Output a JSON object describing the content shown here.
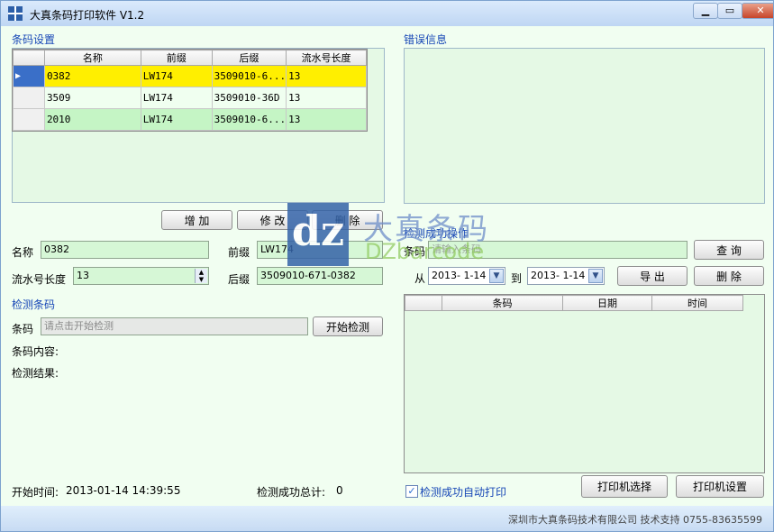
{
  "window": {
    "title": "大真条码打印软件 V1.2",
    "controls": {
      "minimize": "▁",
      "maximize": "▭",
      "close": "✕"
    }
  },
  "barcode_settings": {
    "section_title": "条码设置",
    "columns": [
      "名称",
      "前缀",
      "后缀",
      "流水号长度"
    ],
    "rows": [
      {
        "name": "0382",
        "prefix": "LW174",
        "suffix": "3509010-6...",
        "length": "13"
      },
      {
        "name": "3509",
        "prefix": "LW174",
        "suffix": "3509010-36D",
        "length": "13"
      },
      {
        "name": "2010",
        "prefix": "LW174",
        "suffix": "3509010-6...",
        "length": "13"
      }
    ],
    "add_label": "增 加",
    "edit_label": "修 改",
    "delete_label": "删 除"
  },
  "form": {
    "name_label": "名称",
    "name_value": "0382",
    "prefix_label": "前缀",
    "prefix_value": "LW174",
    "length_label": "流水号长度",
    "length_value": "13",
    "suffix_label": "后缀",
    "suffix_value": "3509010-671-0382"
  },
  "error_info": {
    "section_title": "错误信息"
  },
  "detect": {
    "section_title": "检测条码",
    "barcode_label": "条码",
    "barcode_placeholder": "请点击开始检测",
    "start_label": "开始检测",
    "content_label": "条码内容:",
    "result_label": "检测结果:"
  },
  "success_ops": {
    "section_title": "检测成功操作",
    "barcode_label": "条码",
    "barcode_placeholder": "请输入条码",
    "query_label": "查 询",
    "from_label": "从",
    "from_date": "2013- 1-14",
    "to_label": "到",
    "to_date": "2013- 1-14",
    "export_label": "导 出",
    "delete_label": "删 除",
    "columns": [
      "条码",
      "日期",
      "时间"
    ]
  },
  "footer": {
    "start_time_label": "开始时间:",
    "start_time_value": "2013-01-14 14:39:55",
    "success_total_label": "检测成功总计:",
    "success_total_value": "0",
    "auto_print_label": "检测成功自动打印",
    "printer_select_label": "打印机选择",
    "printer_settings_label": "打印机设置",
    "company": "深圳市大真条码技术有限公司  技术支持  0755-83635599"
  },
  "watermark": {
    "mark": "dz",
    "cn": "大真条码",
    "en": "DZbarcode"
  },
  "colors": {
    "selected_row": "#ffef00",
    "green_row": "#c5f5c5",
    "section_title": "#1747b6"
  }
}
